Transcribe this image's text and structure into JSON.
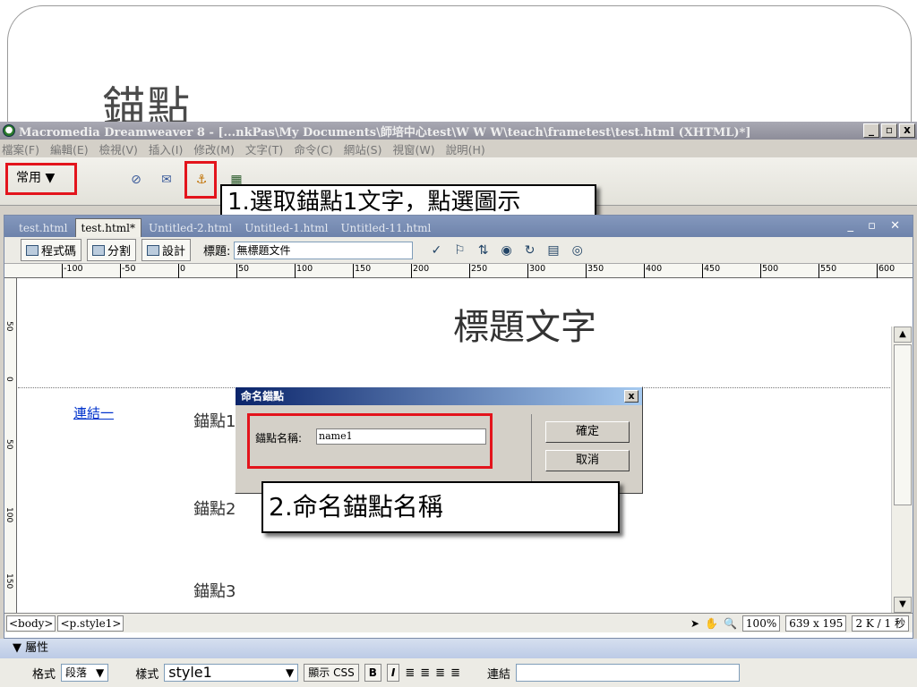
{
  "slide": {
    "title": "錨點"
  },
  "app": {
    "title": "Macromedia Dreamweaver 8 - [...nkPas\\My Documents\\師培中心test\\W W W\\teach\\frametest\\test.html (XHTML)*]",
    "window_controls": [
      "_",
      "▫",
      "x"
    ],
    "menu": [
      "檔案(F)",
      "編輯(E)",
      "檢視(V)",
      "插入(I)",
      "修改(M)",
      "文字(T)",
      "命令(C)",
      "網站(S)",
      "視窗(W)",
      "說明(H)"
    ]
  },
  "insert_bar": {
    "category": "常用",
    "icons": [
      "hyperlink-icon",
      "email-link-icon",
      "named-anchor-icon",
      "table-icon",
      "layer-icon",
      "image-icon",
      "media-icon",
      "date-icon",
      "comment-icon",
      "head-icon",
      "script-icon",
      "templates-icon",
      "tag-chooser-icon"
    ]
  },
  "callouts": {
    "step1": "1.選取錨點1文字，點選圖示",
    "step2": "2.命名錨點名稱"
  },
  "doc_tabs": [
    "test.html",
    "test.html*",
    "Untitled-2.html",
    "Untitled-1.html",
    "Untitled-11.html"
  ],
  "doc_toolbar": {
    "code_btn": "程式碼",
    "split_btn": "分割",
    "design_btn": "設計",
    "title_label": "標題:",
    "title_value": "無標題文件"
  },
  "ruler": {
    "ticks": [
      "-100",
      "-50",
      "0",
      "50",
      "100",
      "150",
      "200",
      "250",
      "300",
      "350",
      "400",
      "450",
      "500",
      "550",
      "600"
    ],
    "left_marks": [
      "50",
      "0",
      "50",
      "100",
      "150"
    ]
  },
  "design": {
    "heading": "標題文字",
    "link": "連結一",
    "anchors": [
      "錨點1",
      "錨點2",
      "錨點3"
    ]
  },
  "dialog": {
    "title": "命名錨點",
    "label": "錨點名稱:",
    "value": "name1",
    "ok": "確定",
    "cancel": "取消",
    "close": "x"
  },
  "status": {
    "tags": [
      "<body>",
      "<p.style1>"
    ],
    "zoom": "100%",
    "size": "639 x 195",
    "download": "2 K / 1 秒"
  },
  "properties": {
    "header": "▼ 屬性",
    "format_label": "格式",
    "format_value": "段落",
    "style_label": "樣式",
    "style_value": "style1",
    "css_btn": "顯示 CSS",
    "bold": "B",
    "italic": "I",
    "link_label": "連結"
  },
  "colors": {
    "highlight": "#e3141c",
    "link": "#0033cc"
  }
}
